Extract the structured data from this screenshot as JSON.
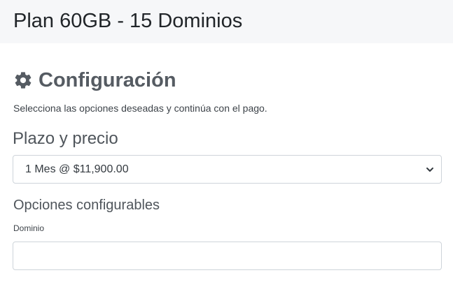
{
  "header": {
    "title": "Plan 60GB - 15 Dominios"
  },
  "config": {
    "icon": "gear-icon",
    "title": "Configuración",
    "subtitle": "Selecciona las opciones deseadas y continúa con el pago."
  },
  "billing": {
    "heading": "Plazo y precio",
    "selected": "1 Mes @ $11,900.00",
    "chevron_icon": "chevron-down-icon"
  },
  "options": {
    "heading": "Opciones configurables",
    "domain_label": "Dominio",
    "domain_value": ""
  },
  "colors": {
    "header_bg": "#f6f7f9",
    "heading_gray": "#555b62",
    "border": "#ced4da"
  }
}
